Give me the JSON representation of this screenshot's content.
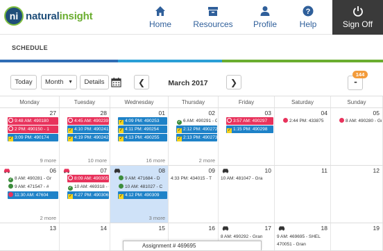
{
  "logo": {
    "mark": "ni",
    "text_part1": "natural",
    "text_part2": "insight"
  },
  "nav": {
    "home": "Home",
    "resources": "Resources",
    "profile": "Profile",
    "help": "Help",
    "signoff": "Sign Off"
  },
  "schedule": {
    "title": "SCHEDULE"
  },
  "toolbar": {
    "today": "Today",
    "view_value": "Month",
    "details": "Details",
    "month_label": "March 2017",
    "badge_count": "144",
    "more_label": "•••"
  },
  "colors": {
    "accent_red": "#e8335c",
    "accent_blue": "#1e82c8",
    "highlight": "#cfe2f8",
    "badge": "#f39c3c"
  },
  "days_of_week": [
    "Monday",
    "Tuesday",
    "Wednesday",
    "Thursday",
    "Friday",
    "Saturday",
    "Sunday"
  ],
  "weeks": [
    {
      "days": [
        {
          "num": "27",
          "events": [
            {
              "text": "9:48 AM: 490180",
              "style": "red",
              "mark": "dot"
            },
            {
              "text": "2 PM: 490150 - 1",
              "style": "red",
              "mark": "dot"
            },
            {
              "text": "3:09 PM: 490174",
              "style": "blue",
              "mark": "chk"
            }
          ],
          "more": "9 more"
        },
        {
          "num": "28",
          "events": [
            {
              "text": "4:45 AM: 490239",
              "style": "red",
              "mark": "dot"
            },
            {
              "text": "4:10 PM: 490241",
              "style": "blue",
              "mark": "chk"
            },
            {
              "text": "4:19 PM: 490242",
              "style": "blue",
              "mark": "chk"
            }
          ],
          "more": "10 more"
        },
        {
          "num": "01",
          "events": [
            {
              "text": "4:09 PM: 490253",
              "style": "blue",
              "mark": "chk"
            },
            {
              "text": "4:11 PM: 490254",
              "style": "blue",
              "mark": "chk"
            },
            {
              "text": "4:13 PM: 490255",
              "style": "blue",
              "mark": "chk"
            }
          ],
          "more": "16 more"
        },
        {
          "num": "02",
          "events": [
            {
              "text": "6 AM: 490291 - Gr",
              "style": "plain",
              "mark": "gchk"
            },
            {
              "text": "2:12 PM: 490272",
              "style": "blue",
              "mark": "chk"
            },
            {
              "text": "2:13 PM: 490273",
              "style": "blue",
              "mark": "chk"
            }
          ],
          "more": "2 more"
        },
        {
          "num": "03",
          "events": [
            {
              "text": "3:57 AM: 490297",
              "style": "red",
              "mark": "dot"
            },
            {
              "text": "1:15 PM: 490298",
              "style": "blue",
              "mark": "chk"
            }
          ],
          "more": ""
        },
        {
          "num": "04",
          "events": [
            {
              "text": "2:44 PM: 433875",
              "style": "plain",
              "mark": "dot"
            }
          ],
          "more": ""
        },
        {
          "num": "05",
          "events": [
            {
              "text": "8 AM: 490280 - Gr",
              "style": "plain",
              "mark": "dot"
            }
          ],
          "more": ""
        }
      ]
    },
    {
      "days": [
        {
          "num": "06",
          "car": true,
          "events": [
            {
              "text": "8 AM: 490281 - Gr",
              "style": "plain",
              "mark": "gcheck"
            },
            {
              "text": "9 AM: 471547 - #",
              "style": "plain",
              "mark": "grdot"
            },
            {
              "text": "11:30 AM: 47604",
              "style": "blue",
              "mark": "dot"
            }
          ],
          "more": "2 more"
        },
        {
          "num": "07",
          "car": true,
          "events": [
            {
              "text": "8:09 AM: 490305",
              "style": "red",
              "mark": "dot"
            },
            {
              "text": "10 AM: 469318 - C",
              "style": "plain",
              "mark": "gcheck"
            },
            {
              "text": "4:27 PM: 490306",
              "style": "blue",
              "mark": "chk"
            }
          ],
          "more": ""
        },
        {
          "num": "08",
          "car": true,
          "events": [
            {
              "text": "9 AM: 471684 - D",
              "style": "plain",
              "mark": "grdot"
            },
            {
              "text": "10 AM: 481027 - C",
              "style": "plain",
              "mark": "grdot"
            },
            {
              "text": "4:12 PM: 490309",
              "style": "blue",
              "mark": "chk"
            }
          ],
          "more": "3 more"
        },
        {
          "num": "09",
          "events": [
            {
              "text": "4:33 PM: 434015 - T",
              "style": "plain",
              "mark": ""
            }
          ],
          "more": ""
        },
        {
          "num": "10",
          "car": true,
          "events": [
            {
              "text": "10 AM: 481047 - Gra",
              "style": "plain",
              "mark": ""
            }
          ],
          "more": ""
        },
        {
          "num": "11",
          "events": [],
          "more": ""
        },
        {
          "num": "12",
          "events": [],
          "more": ""
        }
      ]
    },
    {
      "days": [
        {
          "num": "13",
          "events": [],
          "more": ""
        },
        {
          "num": "14",
          "events": [],
          "more": ""
        },
        {
          "num": "15",
          "events": [],
          "more": ""
        },
        {
          "num": "16",
          "events": [],
          "more": ""
        },
        {
          "num": "17",
          "car": true,
          "events": [
            {
              "text": "8 AM: 490292 - Gran",
              "style": "plain",
              "mark": ""
            }
          ],
          "more": ""
        },
        {
          "num": "18",
          "car": true,
          "events": [
            {
              "text": "9 AM: 469695 - SHEL",
              "style": "plain",
              "mark": ""
            },
            {
              "text": "470051 - Gran",
              "style": "plain",
              "mark": ""
            }
          ],
          "more": ""
        },
        {
          "num": "19",
          "events": [],
          "more": ""
        }
      ]
    }
  ],
  "popup": {
    "text": "Assignment # 469695"
  }
}
